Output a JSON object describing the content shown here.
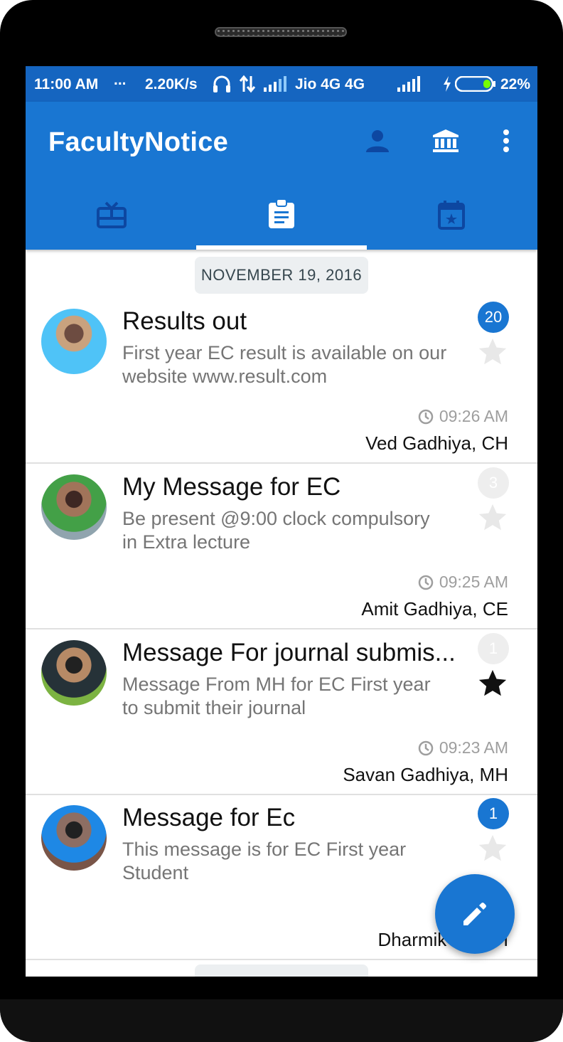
{
  "status_bar": {
    "time": "11:00 AM",
    "dots": "...",
    "network_speed": "2.20K/s",
    "carrier": "Jio 4G 4G",
    "battery": "22%"
  },
  "app_bar": {
    "title": "FacultyNotice",
    "icons": [
      "person-icon",
      "institution-icon",
      "more-vert-icon"
    ]
  },
  "tabs": [
    {
      "icon": "card-giftcard-icon",
      "selected": false
    },
    {
      "icon": "assignment-icon",
      "selected": true
    },
    {
      "icon": "event-star-icon",
      "selected": false
    }
  ],
  "date_header": "NOVEMBER 19, 2016",
  "notices": [
    {
      "title": "Results out",
      "body": "First year EC result is available on our website www.result.com",
      "badge": "20",
      "badge_color": "#1976d2",
      "starred": false,
      "time": "09:26 AM",
      "sender": "Ved Gadhiya, CH"
    },
    {
      "title": "My Message for EC",
      "body": "Be present @9:00 clock compulsory in Extra lecture",
      "badge": "3",
      "badge_color": "#eeeeee",
      "starred": false,
      "time": "09:25 AM",
      "sender": "Amit Gadhiya, CE"
    },
    {
      "title": "Message For journal submis...",
      "body": "Message From MH for EC First year to submit their journal",
      "badge": "1",
      "badge_color": "#eeeeee",
      "starred": true,
      "time": "09:23 AM",
      "sender": "Savan Gadhiya, MH"
    },
    {
      "title": "Message for Ec",
      "body": "This message is for EC First year Student",
      "badge": "1",
      "badge_color": "#1976d2",
      "starred": false,
      "time": "",
      "sender": "Dharmik Pat...H"
    }
  ],
  "fab": {
    "icon": "edit-pencil-icon"
  },
  "colors": {
    "primary": "#1976d2",
    "primary_dark": "#1565c0",
    "tab_inactive": "#0d47a1"
  }
}
